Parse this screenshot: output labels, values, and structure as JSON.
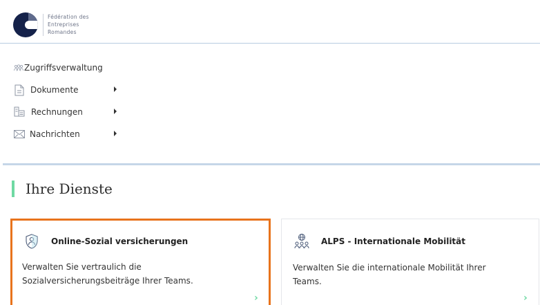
{
  "brand": {
    "name_lines": [
      "Fédération des",
      "Entreprises",
      "Romandes"
    ],
    "colors": {
      "navy": "#15224a",
      "accent_green": "#6fd9a3",
      "active_orange": "#e8731c"
    }
  },
  "nav": {
    "items": [
      {
        "label": "Zugriffsverwaltung",
        "icon": "users-icon",
        "has_submenu": false
      },
      {
        "label": "Dokumente",
        "icon": "document-icon",
        "has_submenu": true
      },
      {
        "label": "Rechnungen",
        "icon": "invoices-icon",
        "has_submenu": true
      },
      {
        "label": "Nachrichten",
        "icon": "envelope-icon",
        "has_submenu": true
      }
    ]
  },
  "services": {
    "heading": "Ihre Dienste",
    "cards": [
      {
        "title": "Online-Sozial versicherungen",
        "description": "Verwalten Sie vertraulich die Sozialversicherungsbeiträge Ihrer Teams.",
        "icon": "shield-person-icon",
        "selected": true
      },
      {
        "title": "ALPS - Internationale Mobilität",
        "description": "Verwalten Sie die internationale Mobilität Ihrer Teams.",
        "icon": "globe-people-icon",
        "selected": false
      }
    ]
  }
}
